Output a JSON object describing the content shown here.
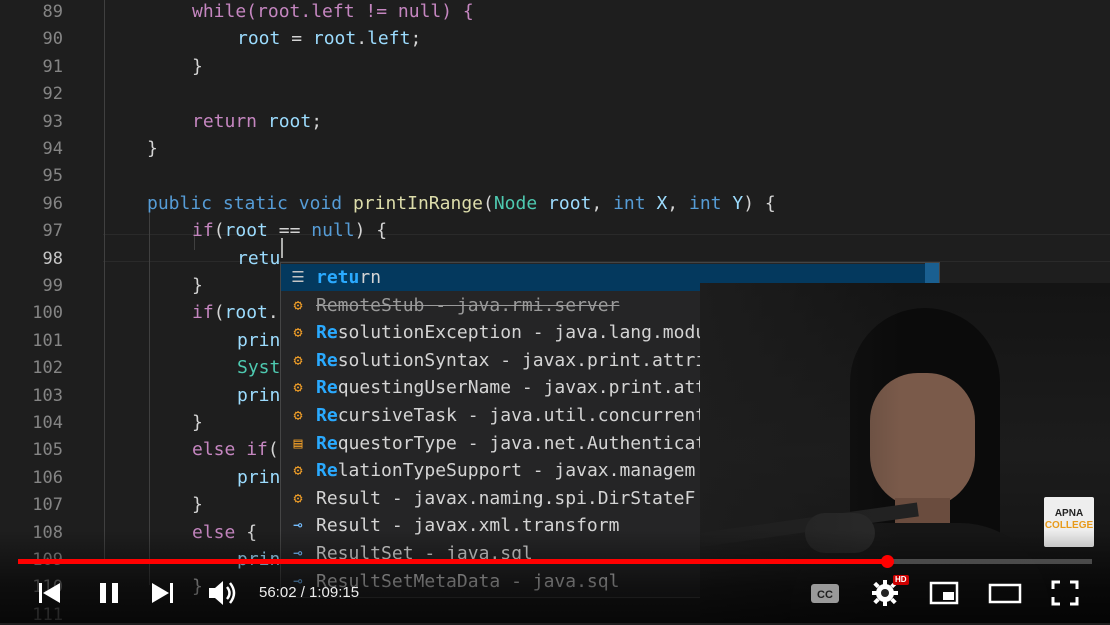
{
  "editor": {
    "lines": [
      {
        "num": "89",
        "tokens": [
          {
            "t": "while(root.left != null) {",
            "c": "kw2"
          }
        ]
      },
      {
        "num": "90",
        "tokens": [
          {
            "t": "root",
            "c": "va"
          },
          {
            "t": " = ",
            "c": "pu"
          },
          {
            "t": "root",
            "c": "va"
          },
          {
            "t": ".",
            "c": "pu"
          },
          {
            "t": "left",
            "c": "va"
          },
          {
            "t": ";",
            "c": "pu"
          }
        ]
      },
      {
        "num": "91",
        "tokens": [
          {
            "t": "}",
            "c": "pu"
          }
        ]
      },
      {
        "num": "92",
        "tokens": []
      },
      {
        "num": "93",
        "tokens": [
          {
            "t": "return",
            "c": "kw2"
          },
          {
            "t": " ",
            "c": "pu"
          },
          {
            "t": "root",
            "c": "va"
          },
          {
            "t": ";",
            "c": "pu"
          }
        ]
      },
      {
        "num": "94",
        "tokens": [
          {
            "t": "}",
            "c": "pu"
          }
        ]
      },
      {
        "num": "95",
        "tokens": []
      },
      {
        "num": "96",
        "tokens": [
          {
            "t": "public",
            "c": "kw"
          },
          {
            "t": " ",
            "c": "pu"
          },
          {
            "t": "static",
            "c": "kw"
          },
          {
            "t": " ",
            "c": "pu"
          },
          {
            "t": "void",
            "c": "kw"
          },
          {
            "t": " ",
            "c": "pu"
          },
          {
            "t": "printInRange",
            "c": "fn"
          },
          {
            "t": "(",
            "c": "pu"
          },
          {
            "t": "Node",
            "c": "ty"
          },
          {
            "t": " ",
            "c": "pu"
          },
          {
            "t": "root",
            "c": "va"
          },
          {
            "t": ", ",
            "c": "pu"
          },
          {
            "t": "int",
            "c": "kw"
          },
          {
            "t": " ",
            "c": "pu"
          },
          {
            "t": "X",
            "c": "va"
          },
          {
            "t": ", ",
            "c": "pu"
          },
          {
            "t": "int",
            "c": "kw"
          },
          {
            "t": " ",
            "c": "pu"
          },
          {
            "t": "Y",
            "c": "va"
          },
          {
            "t": ") {",
            "c": "pu"
          }
        ]
      },
      {
        "num": "97",
        "tokens": [
          {
            "t": "if",
            "c": "kw2"
          },
          {
            "t": "(",
            "c": "pu"
          },
          {
            "t": "root",
            "c": "va"
          },
          {
            "t": " == ",
            "c": "pu"
          },
          {
            "t": "null",
            "c": "kw"
          },
          {
            "t": ") {",
            "c": "pu"
          }
        ]
      },
      {
        "num": "98",
        "tokens": [
          {
            "t": "retu",
            "c": "va"
          }
        ]
      },
      {
        "num": "99",
        "tokens": [
          {
            "t": "}",
            "c": "pu"
          }
        ]
      },
      {
        "num": "100",
        "tokens": [
          {
            "t": "if",
            "c": "kw2"
          },
          {
            "t": "(",
            "c": "pu"
          },
          {
            "t": "root",
            "c": "va"
          },
          {
            "t": ".",
            "c": "pu"
          }
        ]
      },
      {
        "num": "101",
        "tokens": [
          {
            "t": "prin",
            "c": "va"
          }
        ]
      },
      {
        "num": "102",
        "tokens": [
          {
            "t": "Syst",
            "c": "ty"
          }
        ]
      },
      {
        "num": "103",
        "tokens": [
          {
            "t": "prin",
            "c": "va"
          }
        ]
      },
      {
        "num": "104",
        "tokens": [
          {
            "t": "}",
            "c": "pu"
          }
        ]
      },
      {
        "num": "105",
        "tokens": [
          {
            "t": "else",
            "c": "kw2"
          },
          {
            "t": " ",
            "c": "pu"
          },
          {
            "t": "if",
            "c": "kw2"
          },
          {
            "t": "(",
            "c": "pu"
          }
        ]
      },
      {
        "num": "106",
        "tokens": [
          {
            "t": "prin",
            "c": "va"
          }
        ]
      },
      {
        "num": "107",
        "tokens": [
          {
            "t": "}",
            "c": "pu"
          }
        ]
      },
      {
        "num": "108",
        "tokens": [
          {
            "t": "else",
            "c": "kw2"
          },
          {
            "t": " {",
            "c": "pu"
          }
        ]
      },
      {
        "num": "109",
        "tokens": [
          {
            "t": "prin",
            "c": "va"
          }
        ]
      },
      {
        "num": "110",
        "tokens": [
          {
            "t": "}",
            "c": "pu"
          }
        ]
      },
      {
        "num": "111",
        "tokens": []
      }
    ],
    "active_line": "98"
  },
  "suggestions": [
    {
      "icon": "keyword-icon",
      "glyph": "☰",
      "hl": "retu",
      "rest": "rn",
      "detail": "",
      "deprecated": false,
      "selected": true
    },
    {
      "icon": "class-icon",
      "glyph": "⚙",
      "hl": "",
      "rest": "RemoteStub",
      "detail": " - java.rmi.server",
      "deprecated": true,
      "selected": false
    },
    {
      "icon": "class-icon",
      "glyph": "⚙",
      "hl": "Re",
      "rest": "solutionException",
      "detail": " - java.lang.module",
      "deprecated": false,
      "selected": false
    },
    {
      "icon": "class-icon",
      "glyph": "⚙",
      "hl": "Re",
      "rest": "solutionSyntax",
      "detail": " - javax.print.attribute",
      "deprecated": false,
      "selected": false
    },
    {
      "icon": "class-icon",
      "glyph": "⚙",
      "hl": "Re",
      "rest": "questingUserName",
      "detail": " - javax.print.attri",
      "deprecated": false,
      "selected": false
    },
    {
      "icon": "class-icon",
      "glyph": "⚙",
      "hl": "Re",
      "rest": "cursiveTask",
      "detail": " - java.util.concurrent",
      "deprecated": false,
      "selected": false
    },
    {
      "icon": "enum-icon",
      "glyph": "▤",
      "hl": "Re",
      "rest": "questorType",
      "detail": " - java.net.Authenticat",
      "deprecated": false,
      "selected": false
    },
    {
      "icon": "class-icon",
      "glyph": "⚙",
      "hl": "Re",
      "rest": "lationTypeSupport",
      "detail": " - javax.managem",
      "deprecated": false,
      "selected": false
    },
    {
      "icon": "class-icon",
      "glyph": "⚙",
      "hl": "",
      "rest": "Result",
      "detail": " - javax.naming.spi.DirStateF",
      "deprecated": false,
      "selected": false
    },
    {
      "icon": "interface-icon",
      "glyph": "⊸",
      "hl": "",
      "rest": "Result",
      "detail": " - javax.xml.transform",
      "deprecated": false,
      "selected": false
    },
    {
      "icon": "interface-icon",
      "glyph": "⊸",
      "hl": "",
      "rest": "ResultSet",
      "detail": " - java.sql",
      "deprecated": false,
      "selected": false
    },
    {
      "icon": "interface-icon",
      "glyph": "⊸",
      "hl": "",
      "rest": "ResultSetMetaData",
      "detail": " - java.sql",
      "deprecated": false,
      "selected": false
    }
  ],
  "logo": {
    "line1": "APNA",
    "line2": "COLLEGE"
  },
  "player": {
    "current_time": "56:02",
    "duration": "1:09:15",
    "time_text": "56:02 / 1:09:15",
    "progress": 0.809,
    "hd_badge": "HD",
    "accent": "#ff0000",
    "icons": [
      "previous-icon",
      "pause-icon",
      "next-icon",
      "volume-icon",
      "captions-icon",
      "settings-icon",
      "miniplayer-icon",
      "theater-icon",
      "fullscreen-icon"
    ]
  }
}
